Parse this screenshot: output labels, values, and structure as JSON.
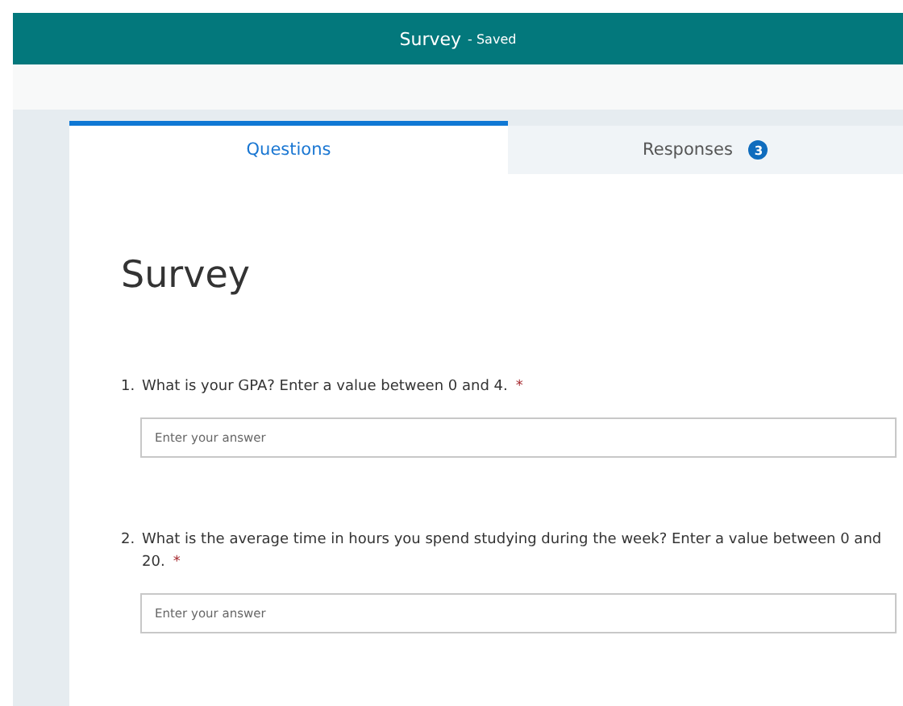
{
  "header": {
    "title": "Survey",
    "status": "- Saved"
  },
  "tabs": [
    {
      "label": "Questions",
      "selected": true
    },
    {
      "label": "Responses",
      "selected": false,
      "badge": "3"
    }
  ],
  "form": {
    "title": "Survey",
    "questions": [
      {
        "number": "1.",
        "text": "What is your GPA? Enter a value between 0 and 4.",
        "required_mark": "*",
        "placeholder": "Enter your answer"
      },
      {
        "number": "2.",
        "text": "What is the average time in hours you spend studying during the week? Enter a value between 0 and 20.",
        "required_mark": "*",
        "placeholder": "Enter your answer"
      }
    ]
  }
}
